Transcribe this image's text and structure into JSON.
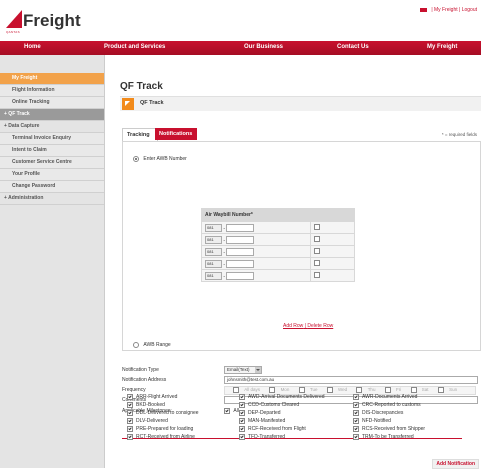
{
  "header": {
    "brand": "Freight",
    "brand_sub": "QANTAS",
    "top_links": "| My Freight | Logout"
  },
  "nav": [
    "Home",
    "Product and Services",
    "Our Business",
    "Contact Us",
    "My Freight"
  ],
  "sidebar": {
    "items": [
      {
        "label": "My Freight",
        "state": "active"
      },
      {
        "label": "Flight Information",
        "state": "sub"
      },
      {
        "label": "Online Tracking",
        "state": "sub"
      },
      {
        "label": "+ QF Track",
        "state": "group"
      },
      {
        "label": "+ Data Capture",
        "state": "plain"
      },
      {
        "label": "Terminal Invoice Enquiry",
        "state": "sub"
      },
      {
        "label": "Intent to Claim",
        "state": "sub"
      },
      {
        "label": "Customer Service Centre",
        "state": "sub"
      },
      {
        "label": "Your Profile",
        "state": "sub"
      },
      {
        "label": "Change Password",
        "state": "sub"
      },
      {
        "label": "+ Administration",
        "state": "plain"
      }
    ]
  },
  "page": {
    "title": "QF Track",
    "subhead": "QF Track",
    "tabs": [
      "Tracking",
      "Notifications"
    ],
    "required_note": "* = required fields"
  },
  "awb": {
    "enter_label": "Enter AWB Number",
    "header": "Air Waybill Number*",
    "prefix": "081",
    "rows": 5,
    "add_row": "Add Row",
    "separator": " | ",
    "delete_row": "Delete Row",
    "range_label": "AWB Range"
  },
  "settings": {
    "type_label": "Notification Type",
    "type_value": "Email(Text)",
    "address_label": "Notification Address",
    "address_value": "johnsmith@test.com.au",
    "frequency_label": "Frequency",
    "frequency_options": [
      "All days",
      "Mon",
      "Tue",
      "Wed",
      "Thu",
      "Fri",
      "Sat",
      "Sun"
    ],
    "comments_label": "Comments",
    "milestones_label": "Applicable Milestones:",
    "milestones_all": "All"
  },
  "milestones": {
    "col1": [
      "ARR-Flight Arrived",
      "BKD-Booked",
      "DDL-Delivered to consignee",
      "DLV-Delivered",
      "PRE-Prepared for loading",
      "RCT-Received from Airline"
    ],
    "col2": [
      "AWD-Arrival Documents Delivered",
      "CCD-Customs Cleared",
      "DEP-Departed",
      "MAN-Manifested",
      "RCF-Received from Flight",
      "TFD-Transferred"
    ],
    "col3": [
      "AWR-Documents Arrived",
      "CRC-Reported to customs",
      "DIS-Discrepancies",
      "NFD-Notified",
      "RCS-Received from Shipper",
      "TRM-To be Transferred"
    ]
  },
  "actions": {
    "add_notification": "Add Notification"
  },
  "colors": {
    "brand_red": "#c8102e",
    "accent_orange": "#f2a24a"
  }
}
